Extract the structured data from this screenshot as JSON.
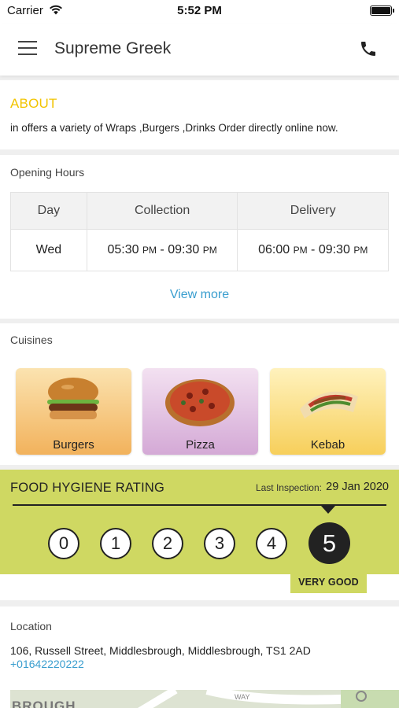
{
  "status_bar": {
    "carrier": "Carrier",
    "time": "5:52 PM"
  },
  "header": {
    "title": "Supreme Greek",
    "menu_icon": "hamburger-menu-icon",
    "phone_icon": "phone-icon"
  },
  "about": {
    "heading": "ABOUT",
    "description": "in  offers a variety of Wraps ,Burgers ,Drinks Order directly online now."
  },
  "opening_hours": {
    "label": "Opening Hours",
    "columns": [
      "Day",
      "Collection",
      "Delivery"
    ],
    "rows": [
      {
        "day": "Wed",
        "collection_start": "05:30",
        "collection_start_ampm": "PM",
        "collection_end": "09:30",
        "collection_end_ampm": "PM",
        "delivery_start": "06:00",
        "delivery_start_ampm": "PM",
        "delivery_end": "09:30",
        "delivery_end_ampm": "PM"
      }
    ],
    "view_more": "View more"
  },
  "cuisines": {
    "label": "Cuisines",
    "items": [
      {
        "name": "Burgers",
        "icon": "burger-image"
      },
      {
        "name": "Pizza",
        "icon": "pizza-image"
      },
      {
        "name": "Kebab",
        "icon": "kebab-image"
      }
    ]
  },
  "hygiene": {
    "title": "FOOD HYGIENE RATING",
    "inspection_label": "Last Inspection:",
    "inspection_date": "29 Jan 2020",
    "scale": [
      "0",
      "1",
      "2",
      "3",
      "4",
      "5"
    ],
    "rating": "5",
    "verdict": "VERY GOOD",
    "band_color": "#cfd862"
  },
  "location": {
    "label": "Location",
    "address": "106, Russell Street, Middlesbrough, Middlesbrough, TS1 2AD",
    "phone": "+01642220222",
    "map_labels": [
      "BROUGH",
      "WAY"
    ]
  },
  "colors": {
    "accent_about": "#f2c400",
    "link": "#3a9ecf"
  }
}
